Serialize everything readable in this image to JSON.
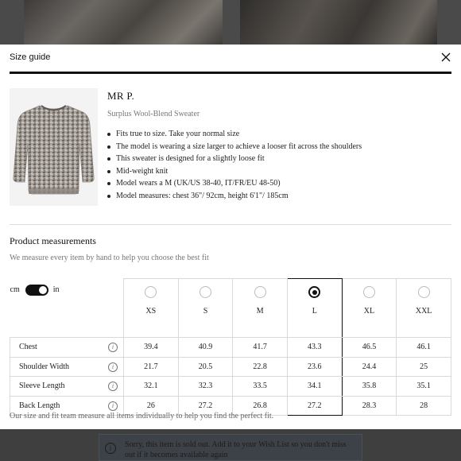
{
  "modal": {
    "title": "Size guide",
    "close_icon": "close-icon"
  },
  "product": {
    "brand": "MR P.",
    "name": "Surplus Wool-Blend Sweater",
    "notes": [
      "Fits true to size. Take your normal size",
      "The model is wearing a size larger to achieve a looser fit across the shoulders",
      "This sweater is designed for a slightly loose fit",
      "Mid-weight knit",
      "Model wears a M (UK/US 38-40, IT/FR/EU 48-50)",
      "Model measures: chest 36\"/ 92cm, height 6'1\"/ 185cm"
    ]
  },
  "measurements": {
    "title": "Product measurements",
    "subtitle": "We measure every item by hand to help you choose the best fit",
    "unit_left": "cm",
    "unit_right": "in",
    "unit_selected": "in",
    "sizes": [
      "XS",
      "S",
      "M",
      "L",
      "XL",
      "XXL"
    ],
    "selected_size": "L",
    "rows": [
      {
        "label": "Chest",
        "values": [
          "39.4",
          "40.9",
          "41.7",
          "43.3",
          "46.5",
          "46.1"
        ]
      },
      {
        "label": "Shoulder Width",
        "values": [
          "21.7",
          "20.5",
          "22.8",
          "23.6",
          "24.4",
          "25"
        ]
      },
      {
        "label": "Sleeve Length",
        "values": [
          "32.1",
          "32.3",
          "33.5",
          "34.1",
          "35.8",
          "35.1"
        ]
      },
      {
        "label": "Back Length",
        "values": [
          "26",
          "27.2",
          "26.8",
          "27.2",
          "28.3",
          "28"
        ]
      }
    ],
    "info_icon_glyph": "i",
    "footer_note": "Our size and fit team measure all items individually to help you find the perfect fit."
  },
  "notice": {
    "icon_glyph": "i",
    "text": "Sorry, this item is sold out. Add it to your Wish List so you don't miss out if it becomes available again"
  },
  "colors": {
    "accent": "#111111",
    "muted_text": "#777777",
    "border": "#d9d9d9",
    "overlay": "#3f3f3f"
  }
}
